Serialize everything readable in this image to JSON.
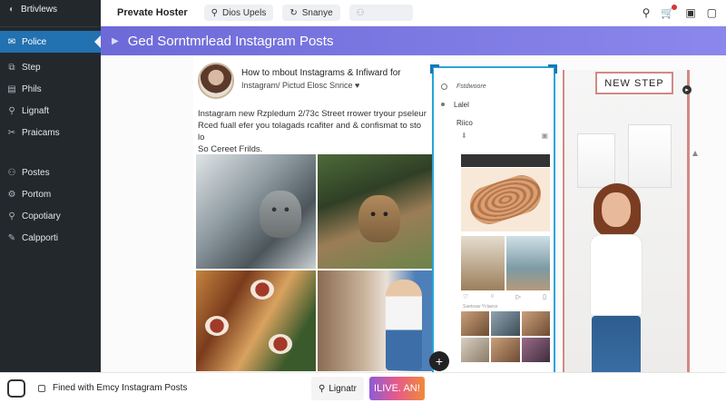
{
  "sidebar": {
    "title": "Brtivlews",
    "items": [
      {
        "label": "Police",
        "icon": "mail-icon"
      },
      {
        "label": "Step",
        "icon": "layers-icon"
      },
      {
        "label": "Phils",
        "icon": "pages-icon"
      },
      {
        "label": "Lignaft",
        "icon": "search-icon"
      },
      {
        "label": "Praicams",
        "icon": "tools-icon"
      },
      {
        "label": "Postes",
        "icon": "user-icon"
      },
      {
        "label": "Portom",
        "icon": "settings-icon"
      },
      {
        "label": "Copotiary",
        "icon": "pin-icon"
      },
      {
        "label": "Calpporti",
        "icon": "edit-icon"
      }
    ]
  },
  "topbar": {
    "brand": "Prevate Hoster",
    "pill1": "Dios Upels",
    "pill2": "Snanye"
  },
  "banner": {
    "title": "Ged Sorntmrlead Instagram Posts"
  },
  "post": {
    "title": "How to mbout Instagrams & Infiward for",
    "subtitle": "Instagram/ Pictud Elosc Snrice ♥",
    "caption_line1": "Instagram new Rzpledum 2/73c Street rrower tryour pseleur",
    "caption_line2": "Rced fuall efer you tolagads rcafiter and & confismat to sto lo",
    "caption_line3": "So Cereet Frilds."
  },
  "phone": {
    "menu_item1": "Fstdwoore",
    "menu_item2": "Lalel",
    "menu_item3": "Riico",
    "caption": "Saetoaw Yclaess"
  },
  "hero": {
    "badge": "NEW STEP"
  },
  "bottom": {
    "text": "Fined with Emcy Instagram Posts",
    "lignatr": "Lignatr",
    "live": "ILIVE. AN!"
  },
  "colors": {
    "sidebar_bg": "#23282d",
    "active": "#2271b1",
    "banner": "#7a76e2",
    "phone_border": "#27a4d8",
    "hero_border": "#d08a83"
  }
}
